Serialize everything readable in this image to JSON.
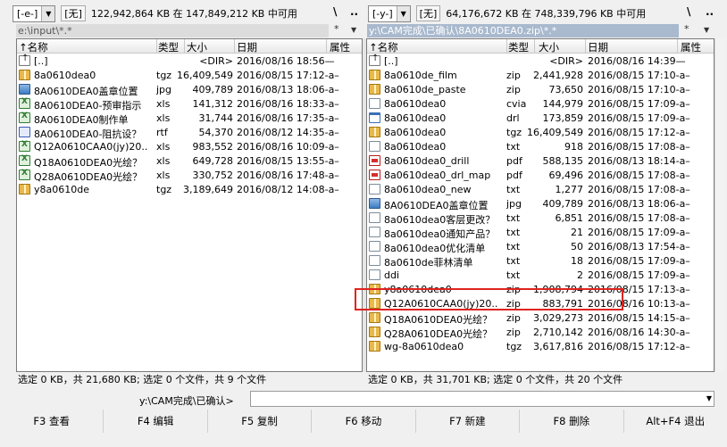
{
  "left": {
    "drive": "[-e-]",
    "label": "[无]",
    "space": "122,942,864 KB 在 147,849,212 KB 中可用",
    "root_btn": "\\",
    "up_btn": "..",
    "path": "e:\\input\\*.*",
    "path_tool_star": "*",
    "path_tool_arrow": "▼",
    "headers": {
      "name": "↑名称",
      "ext": "类型",
      "size": "大小",
      "date": "日期",
      "attr": "属性"
    },
    "rows": [
      {
        "icon": "up-icon",
        "name": "[..]",
        "ext": "",
        "size": "<DIR>",
        "date": "2016/08/16 18:56—"
      },
      {
        "icon": "archive-icon",
        "name": "8a0610dea0",
        "ext": "tgz",
        "size": "16,409,549",
        "date": "2016/08/15 17:12-a–"
      },
      {
        "icon": "image-icon",
        "name": "8A0610DEA0盖章位置",
        "ext": "jpg",
        "size": "409,789",
        "date": "2016/08/13 18:06-a–"
      },
      {
        "icon": "excel-icon",
        "name": "8A0610DEA0-预审指示",
        "ext": "xls",
        "size": "141,312",
        "date": "2016/08/16 18:33-a–"
      },
      {
        "icon": "excel-icon",
        "name": "8A0610DEA0制作单",
        "ext": "xls",
        "size": "31,744",
        "date": "2016/08/16 17:35-a–"
      },
      {
        "icon": "rtf-icon",
        "name": "8A0610DEA0-阻抗设？",
        "ext": "rtf",
        "size": "54,370",
        "date": "2016/08/12 14:35-a–"
      },
      {
        "icon": "excel-icon",
        "name": "Q12A0610CAA0(jy)20..",
        "ext": "xls",
        "size": "983,552",
        "date": "2016/08/16 10:09-a–"
      },
      {
        "icon": "excel-icon",
        "name": "Q18A0610DEA0光绘？",
        "ext": "xls",
        "size": "649,728",
        "date": "2016/08/15 13:55-a–"
      },
      {
        "icon": "excel-icon",
        "name": "Q28A0610DEA0光绘？",
        "ext": "xls",
        "size": "330,752",
        "date": "2016/08/16 17:48-a–"
      },
      {
        "icon": "archive-icon",
        "name": "y8a0610de",
        "ext": "tgz",
        "size": "3,189,649",
        "date": "2016/08/12 14:08-a–"
      }
    ],
    "status": "选定 0 KB，共 21,680 KB; 选定 0 个文件，共 9 个文件"
  },
  "right": {
    "drive": "[-y-]",
    "label": "[无]",
    "space": "64,176,672 KB 在 748,339,796 KB 中可用",
    "root_btn": "\\",
    "up_btn": "..",
    "path": "y:\\CAM完成\\已确认\\8A0610DEA0.zip\\*.*",
    "path_tool_star": "*",
    "path_tool_arrow": "▼",
    "headers": {
      "name": "↑名称",
      "ext": "类型",
      "size": "大小",
      "date": "日期",
      "attr": "属性"
    },
    "rows": [
      {
        "icon": "up-icon",
        "name": "[..]",
        "ext": "",
        "size": "<DIR>",
        "date": "2016/08/16 14:39—"
      },
      {
        "icon": "archive-icon",
        "name": "8a0610de_film",
        "ext": "zip",
        "size": "2,441,928",
        "date": "2016/08/15 17:10-a–"
      },
      {
        "icon": "archive-icon",
        "name": "8a0610de_paste",
        "ext": "zip",
        "size": "73,650",
        "date": "2016/08/15 17:10-a–"
      },
      {
        "icon": "doc-icon",
        "name": "8a0610dea0",
        "ext": "cvia",
        "size": "144,979",
        "date": "2016/08/15 17:09-a–"
      },
      {
        "icon": "app-icon",
        "name": "8a0610dea0",
        "ext": "drl",
        "size": "173,859",
        "date": "2016/08/15 17:09-a–"
      },
      {
        "icon": "archive-icon",
        "name": "8a0610dea0",
        "ext": "tgz",
        "size": "16,409,549",
        "date": "2016/08/15 17:12-a–"
      },
      {
        "icon": "doc-icon",
        "name": "8a0610dea0",
        "ext": "txt",
        "size": "918",
        "date": "2016/08/15 17:08-a–"
      },
      {
        "icon": "pdf-icon",
        "name": "8a0610dea0_drill",
        "ext": "pdf",
        "size": "588,135",
        "date": "2016/08/13 18:14-a–"
      },
      {
        "icon": "pdf-icon",
        "name": "8a0610dea0_drl_map",
        "ext": "pdf",
        "size": "69,496",
        "date": "2016/08/15 17:08-a–"
      },
      {
        "icon": "doc-icon",
        "name": "8a0610dea0_new",
        "ext": "txt",
        "size": "1,277",
        "date": "2016/08/15 17:08-a–"
      },
      {
        "icon": "image-icon",
        "name": "8A0610DEA0盖章位置",
        "ext": "jpg",
        "size": "409,789",
        "date": "2016/08/13 18:06-a–"
      },
      {
        "icon": "doc-icon",
        "name": "8a0610dea0客层更改？",
        "ext": "txt",
        "size": "6,851",
        "date": "2016/08/15 17:08-a–"
      },
      {
        "icon": "doc-icon",
        "name": "8a0610dea0通知产品？",
        "ext": "txt",
        "size": "21",
        "date": "2016/08/15 17:09-a–"
      },
      {
        "icon": "doc-icon",
        "name": "8a0610dea0优化清单",
        "ext": "txt",
        "size": "50",
        "date": "2016/08/13 17:54-a–"
      },
      {
        "icon": "doc-icon",
        "name": "8a0610de菲林清单",
        "ext": "txt",
        "size": "18",
        "date": "2016/08/15 17:09-a–"
      },
      {
        "icon": "doc-icon",
        "name": "ddi",
        "ext": "txt",
        "size": "2",
        "date": "2016/08/15 17:09-a–"
      },
      {
        "icon": "archive-icon",
        "name": "y8a0610dea0",
        "ext": "zip",
        "size": "1,908,794",
        "date": "2016/08/15 17:13-a–"
      },
      {
        "icon": "archive-icon",
        "name": "Q12A0610CAA0(jy)20..",
        "ext": "zip",
        "size": "883,791",
        "date": "2016/08/16 10:13-a–"
      },
      {
        "icon": "archive-icon",
        "name": "Q18A0610DEA0光绘？",
        "ext": "zip",
        "size": "3,029,273",
        "date": "2016/08/15 14:15-a–"
      },
      {
        "icon": "archive-icon",
        "name": "Q28A0610DEA0光绘？",
        "ext": "zip",
        "size": "2,710,142",
        "date": "2016/08/16 14:30-a–"
      },
      {
        "icon": "archive-icon",
        "name": "wg-8a0610dea0",
        "ext": "tgz",
        "size": "3,617,816",
        "date": "2016/08/15 17:12-a–"
      }
    ],
    "status": "选定 0 KB，共 31,701 KB; 选定 0 个文件，共 20 个文件"
  },
  "command_line": {
    "prompt": "y:\\CAM完成\\已确认>",
    "value": ""
  },
  "fkeys": [
    "F3 查看",
    "F4 编辑",
    "F5 复制",
    "F6 移动",
    "F7 新建",
    "F8 删除",
    "Alt+F4 退出"
  ],
  "colors": {
    "highlight": "#e0231f",
    "active_path": "#a9b9ce"
  }
}
